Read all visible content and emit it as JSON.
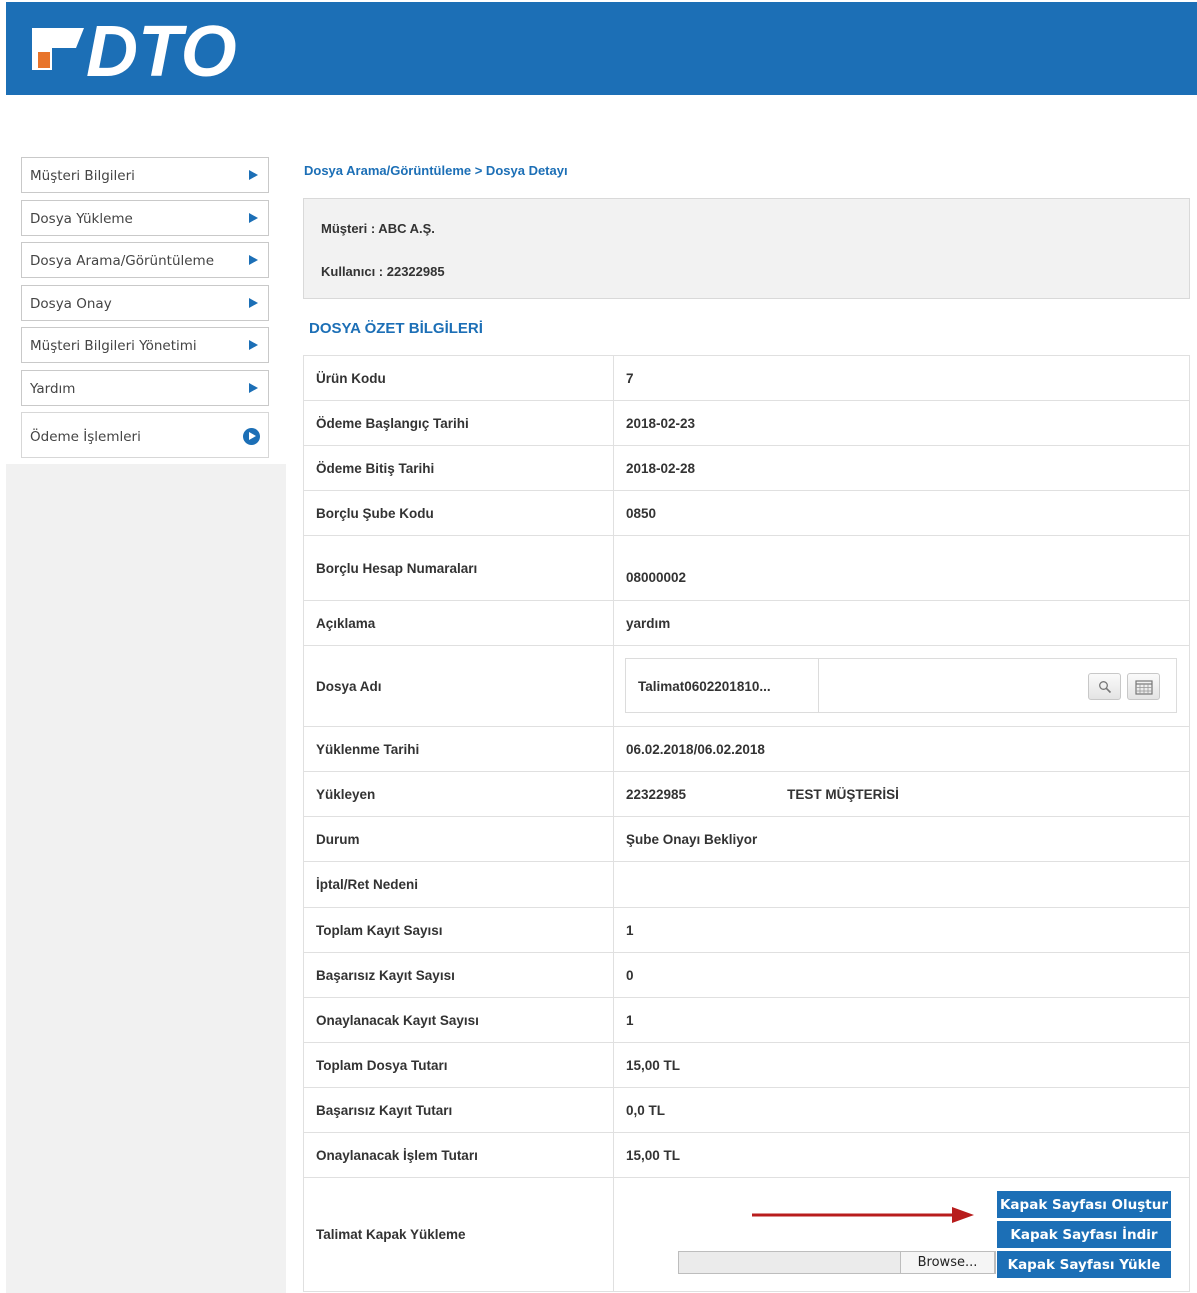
{
  "header": {
    "logo_text": "DTO",
    "brand_color": "#1c6fb6"
  },
  "sidebar": {
    "items": [
      {
        "label": "Müşteri Bilgileri",
        "icon": "arrow-right-icon"
      },
      {
        "label": "Dosya Yükleme",
        "icon": "arrow-right-icon"
      },
      {
        "label": "Dosya Arama/Görüntüleme",
        "icon": "arrow-right-icon"
      },
      {
        "label": "Dosya Onay",
        "icon": "arrow-right-icon"
      },
      {
        "label": "Müşteri Bilgileri Yönetimi",
        "icon": "arrow-right-icon"
      },
      {
        "label": "Yardım",
        "icon": "arrow-right-icon"
      },
      {
        "label": "Ödeme İşlemleri",
        "icon": "circle-arrow-icon"
      }
    ]
  },
  "breadcrumb": "Dosya Arama/Görüntüleme > Dosya Detayı",
  "info": {
    "customer": "Müşteri :  ABC A.Ş.",
    "user": "Kullanıcı : 22322985"
  },
  "section_title": "DOSYA ÖZET BİLGİLERİ",
  "rows": [
    {
      "label": "Ürün Kodu",
      "value": "7"
    },
    {
      "label": "Ödeme Başlangıç Tarihi",
      "value": "2018-02-23"
    },
    {
      "label": "Ödeme Bitiş Tarihi",
      "value": "2018-02-28"
    },
    {
      "label": "Borçlu Şube Kodu",
      "value": "0850"
    },
    {
      "label": "Borçlu Hesap Numaraları",
      "value": "08000002"
    },
    {
      "label": "Açıklama",
      "value": "yardım"
    },
    {
      "label": "Dosya Adı",
      "value": "Talimat0602201810..."
    },
    {
      "label": "Yüklenme Tarihi",
      "value": "06.02.2018/06.02.2018"
    },
    {
      "label": "Yükleyen",
      "value": "22322985",
      "value2": "TEST MÜŞTERİSİ"
    },
    {
      "label": "Durum",
      "value": "Şube Onayı Bekliyor"
    },
    {
      "label": "İptal/Ret Nedeni",
      "value": ""
    },
    {
      "label": "Toplam Kayıt Sayısı",
      "value": "1"
    },
    {
      "label": "Başarısız Kayıt Sayısı",
      "value": "0"
    },
    {
      "label": "Onaylanacak Kayıt Sayısı",
      "value": "1"
    },
    {
      "label": "Toplam Dosya Tutarı",
      "value": "15,00 TL"
    },
    {
      "label": "Başarısız Kayıt Tutarı",
      "value": "0,0 TL"
    },
    {
      "label": "Onaylanacak İşlem Tutarı",
      "value": "15,00 TL"
    },
    {
      "label": "Talimat Kapak Yükleme",
      "value": ""
    }
  ],
  "cover": {
    "create_label": "Kapak Sayfası Oluştur",
    "download_label": "Kapak Sayfası İndir",
    "upload_label": "Kapak Sayfası Yükle",
    "browse_label": "Browse..."
  }
}
